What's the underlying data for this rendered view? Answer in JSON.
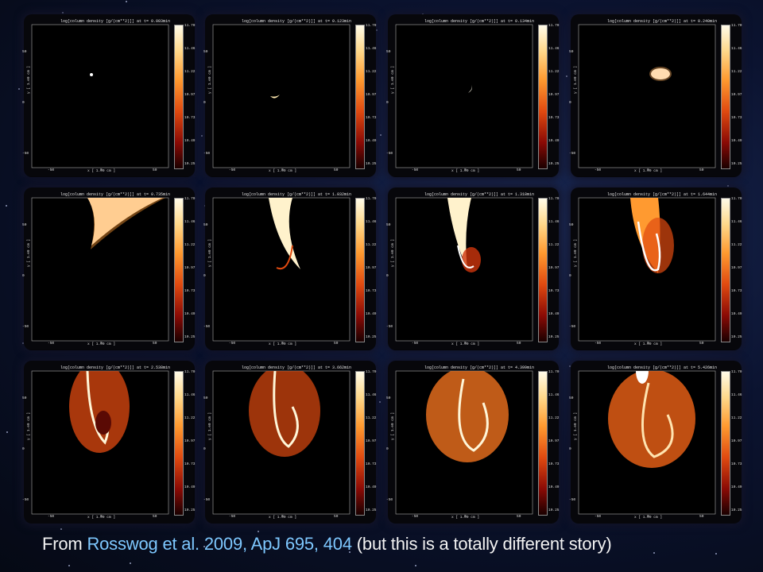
{
  "panels": [
    {
      "title": "log[column density [g/(cm**2)]] at t=  0.003min",
      "time": 0.003
    },
    {
      "title": "log[column density [g/(cm**2)]] at t=  0.123min",
      "time": 0.123
    },
    {
      "title": "log[column density [g/(cm**2)]] at t=  0.134min",
      "time": 0.134
    },
    {
      "title": "log[column density [g/(cm**2)]] at t=  0.240min",
      "time": 0.24
    },
    {
      "title": "log[column density [g/(cm**2)]] at t=  0.735min",
      "time": 0.735
    },
    {
      "title": "log[column density [g/(cm**2)]] at t=  1.032min",
      "time": 1.032
    },
    {
      "title": "log[column density [g/(cm**2)]] at t=  1.318min",
      "time": 1.318
    },
    {
      "title": "log[column density [g/(cm**2)]] at t=  1.644min",
      "time": 1.644
    },
    {
      "title": "log[column density [g/(cm**2)]] at t=  2.538min",
      "time": 2.538
    },
    {
      "title": "log[column density [g/(cm**2)]] at t=  3.662min",
      "time": 3.662
    },
    {
      "title": "log[column density [g/(cm**2)]] at t=  4.399min",
      "time": 4.399
    },
    {
      "title": "log[column density [g/(cm**2)]] at t=  5.426min",
      "time": 5.426
    }
  ],
  "colorbar_ticks": [
    "11.70",
    "11.46",
    "11.22",
    "10.97",
    "10.73",
    "10.49",
    "10.25"
  ],
  "x_ticks": [
    "-50",
    "0",
    "50"
  ],
  "y_ticks": [
    "50",
    "0",
    "-50"
  ],
  "x_label": "x [ 1.e9 cm ]",
  "y_label": "y [ 1.e9 cm ]",
  "caption": {
    "prefix": "From ",
    "link": "Rosswog et al. 2009, ApJ 695, 404",
    "suffix": " (but this is a totally different story)"
  },
  "colors": {
    "link": "#7ec8ff",
    "text": "#f2f2f2"
  }
}
